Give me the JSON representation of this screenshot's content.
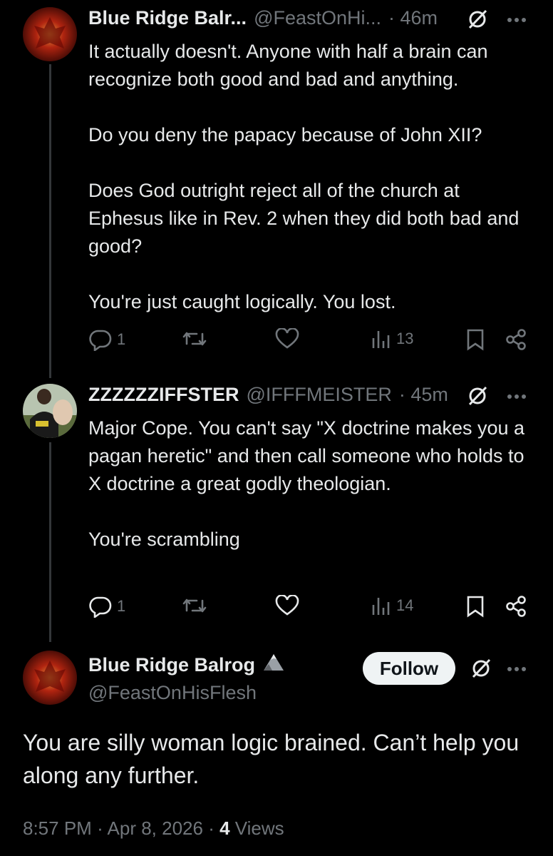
{
  "posts": [
    {
      "name": "Blue Ridge Balr...",
      "handle": "@FeastOnHi...",
      "time": "· 46m",
      "text": "It actually doesn't. Anyone with half a brain can recognize both good and bad and anything.\n\nDo you deny the papacy because of John XII?\n\nDoes God outright reject all of the church at Ephesus like in Rev. 2 when they did both bad and good?\n\nYou're just caught logically. You lost.",
      "replies": "1",
      "views": "13"
    },
    {
      "name": "ZZZZZZIFFSTER",
      "handle": "@IFFFMEISTER",
      "time": "· 45m",
      "text": "Major Cope. You can't say \"X doctrine makes you a pagan heretic\" and then call someone who holds to X doctrine a great godly theologian.\n\nYou're scrambling",
      "replies": "1",
      "views": "14"
    }
  ],
  "main_post": {
    "name": "Blue Ridge Balrog",
    "handle": "@FeastOnHisFlesh",
    "follow_label": "Follow",
    "text": "You are silly woman logic brained. Can’t help you along any further.",
    "time": "8:57 PM",
    "date": "Apr 8, 2026",
    "views_count": "4",
    "views_label": "Views"
  },
  "icons": {
    "reply": "reply-icon",
    "repost": "repost-icon",
    "like": "like-icon",
    "views": "views-icon",
    "bookmark": "bookmark-icon",
    "share": "share-icon",
    "grok": "grok-icon",
    "more": "more-icon"
  },
  "colors": {
    "background": "#000000",
    "text": "#e7e9ea",
    "secondary": "#71767b",
    "follow_bg": "#eff3f4"
  }
}
